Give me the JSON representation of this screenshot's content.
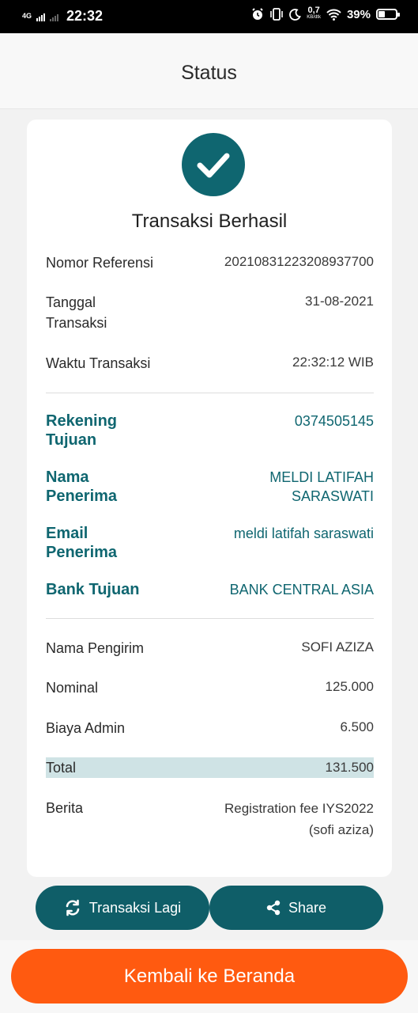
{
  "statusbar": {
    "network": "4G",
    "time": "22:32",
    "speed_value": "0,7",
    "speed_unit": "KB/dtk",
    "battery": "39%"
  },
  "header": {
    "title": "Status"
  },
  "result": {
    "icon": "check-icon",
    "title": "Transaksi Berhasil"
  },
  "details": {
    "ref_label": "Nomor Referensi",
    "ref_value": "20210831223208937700",
    "date_label_1": "Tanggal",
    "date_label_2": "Transaksi",
    "date_value": "31-08-2021",
    "time_label": "Waktu Transaksi",
    "time_value": "22:32:12 WIB"
  },
  "recipient": {
    "account_label_1": "Rekening",
    "account_label_2": "Tujuan",
    "account_value": "0374505145",
    "name_label_1": "Nama",
    "name_label_2": "Penerima",
    "name_value_1": "MELDI LATIFAH",
    "name_value_2": "SARASWATI",
    "email_label_1": "Email",
    "email_label_2": "Penerima",
    "email_value": "meldi latifah saraswati",
    "bank_label": "Bank Tujuan",
    "bank_value": "BANK CENTRAL ASIA"
  },
  "summary": {
    "sender_label": "Nama Pengirim",
    "sender_value": "SOFI AZIZA",
    "nominal_label": "Nominal",
    "nominal_value": "125.000",
    "fee_label": "Biaya Admin",
    "fee_value": "6.500",
    "total_label": "Total",
    "total_value": "131.500",
    "note_label": "Berita",
    "note_value_1": "Registration fee IYS2022",
    "note_value_2": "(sofi aziza)"
  },
  "actions": {
    "repeat_label": "Transaksi Lagi",
    "repeat_icon": "refresh-icon",
    "share_label": "Share",
    "share_icon": "share-icon",
    "home_label": "Kembali ke Beranda"
  },
  "colors": {
    "teal": "#0f6670",
    "button_teal": "#0f5e68",
    "orange": "#ff5a10",
    "total_highlight": "#cfe3e5"
  }
}
